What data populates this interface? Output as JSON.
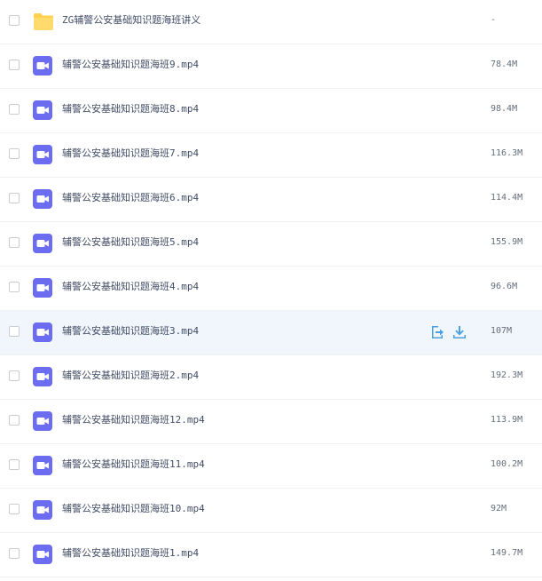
{
  "colors": {
    "accent": "#4aa0e0",
    "folder": "#ffd14d",
    "video_icon": "#6c6cf0",
    "hover_row": "#f1f6fd"
  },
  "rows": [
    {
      "name": "ZG辅警公安基础知识题海班讲义",
      "size": "-",
      "icon": "folder-icon"
    },
    {
      "name": "辅警公安基础知识题海班9.mp4",
      "size": "78.4M",
      "icon": "video-file-icon"
    },
    {
      "name": "辅警公安基础知识题海班8.mp4",
      "size": "98.4M",
      "icon": "video-file-icon"
    },
    {
      "name": "辅警公安基础知识题海班7.mp4",
      "size": "116.3M",
      "icon": "video-file-icon"
    },
    {
      "name": "辅警公安基础知识题海班6.mp4",
      "size": "114.4M",
      "icon": "video-file-icon"
    },
    {
      "name": "辅警公安基础知识题海班5.mp4",
      "size": "155.9M",
      "icon": "video-file-icon"
    },
    {
      "name": "辅警公安基础知识题海班4.mp4",
      "size": "96.6M",
      "icon": "video-file-icon"
    },
    {
      "name": "辅警公安基础知识题海班3.mp4",
      "size": "107M",
      "icon": "video-file-icon",
      "hovered": true,
      "actions": [
        "share-icon",
        "download-icon"
      ]
    },
    {
      "name": "辅警公安基础知识题海班2.mp4",
      "size": "192.3M",
      "icon": "video-file-icon"
    },
    {
      "name": "辅警公安基础知识题海班12.mp4",
      "size": "113.9M",
      "icon": "video-file-icon"
    },
    {
      "name": "辅警公安基础知识题海班11.mp4",
      "size": "100.2M",
      "icon": "video-file-icon"
    },
    {
      "name": "辅警公安基础知识题海班10.mp4",
      "size": "92M",
      "icon": "video-file-icon"
    },
    {
      "name": "辅警公安基础知识题海班1.mp4",
      "size": "149.7M",
      "icon": "video-file-icon"
    }
  ]
}
